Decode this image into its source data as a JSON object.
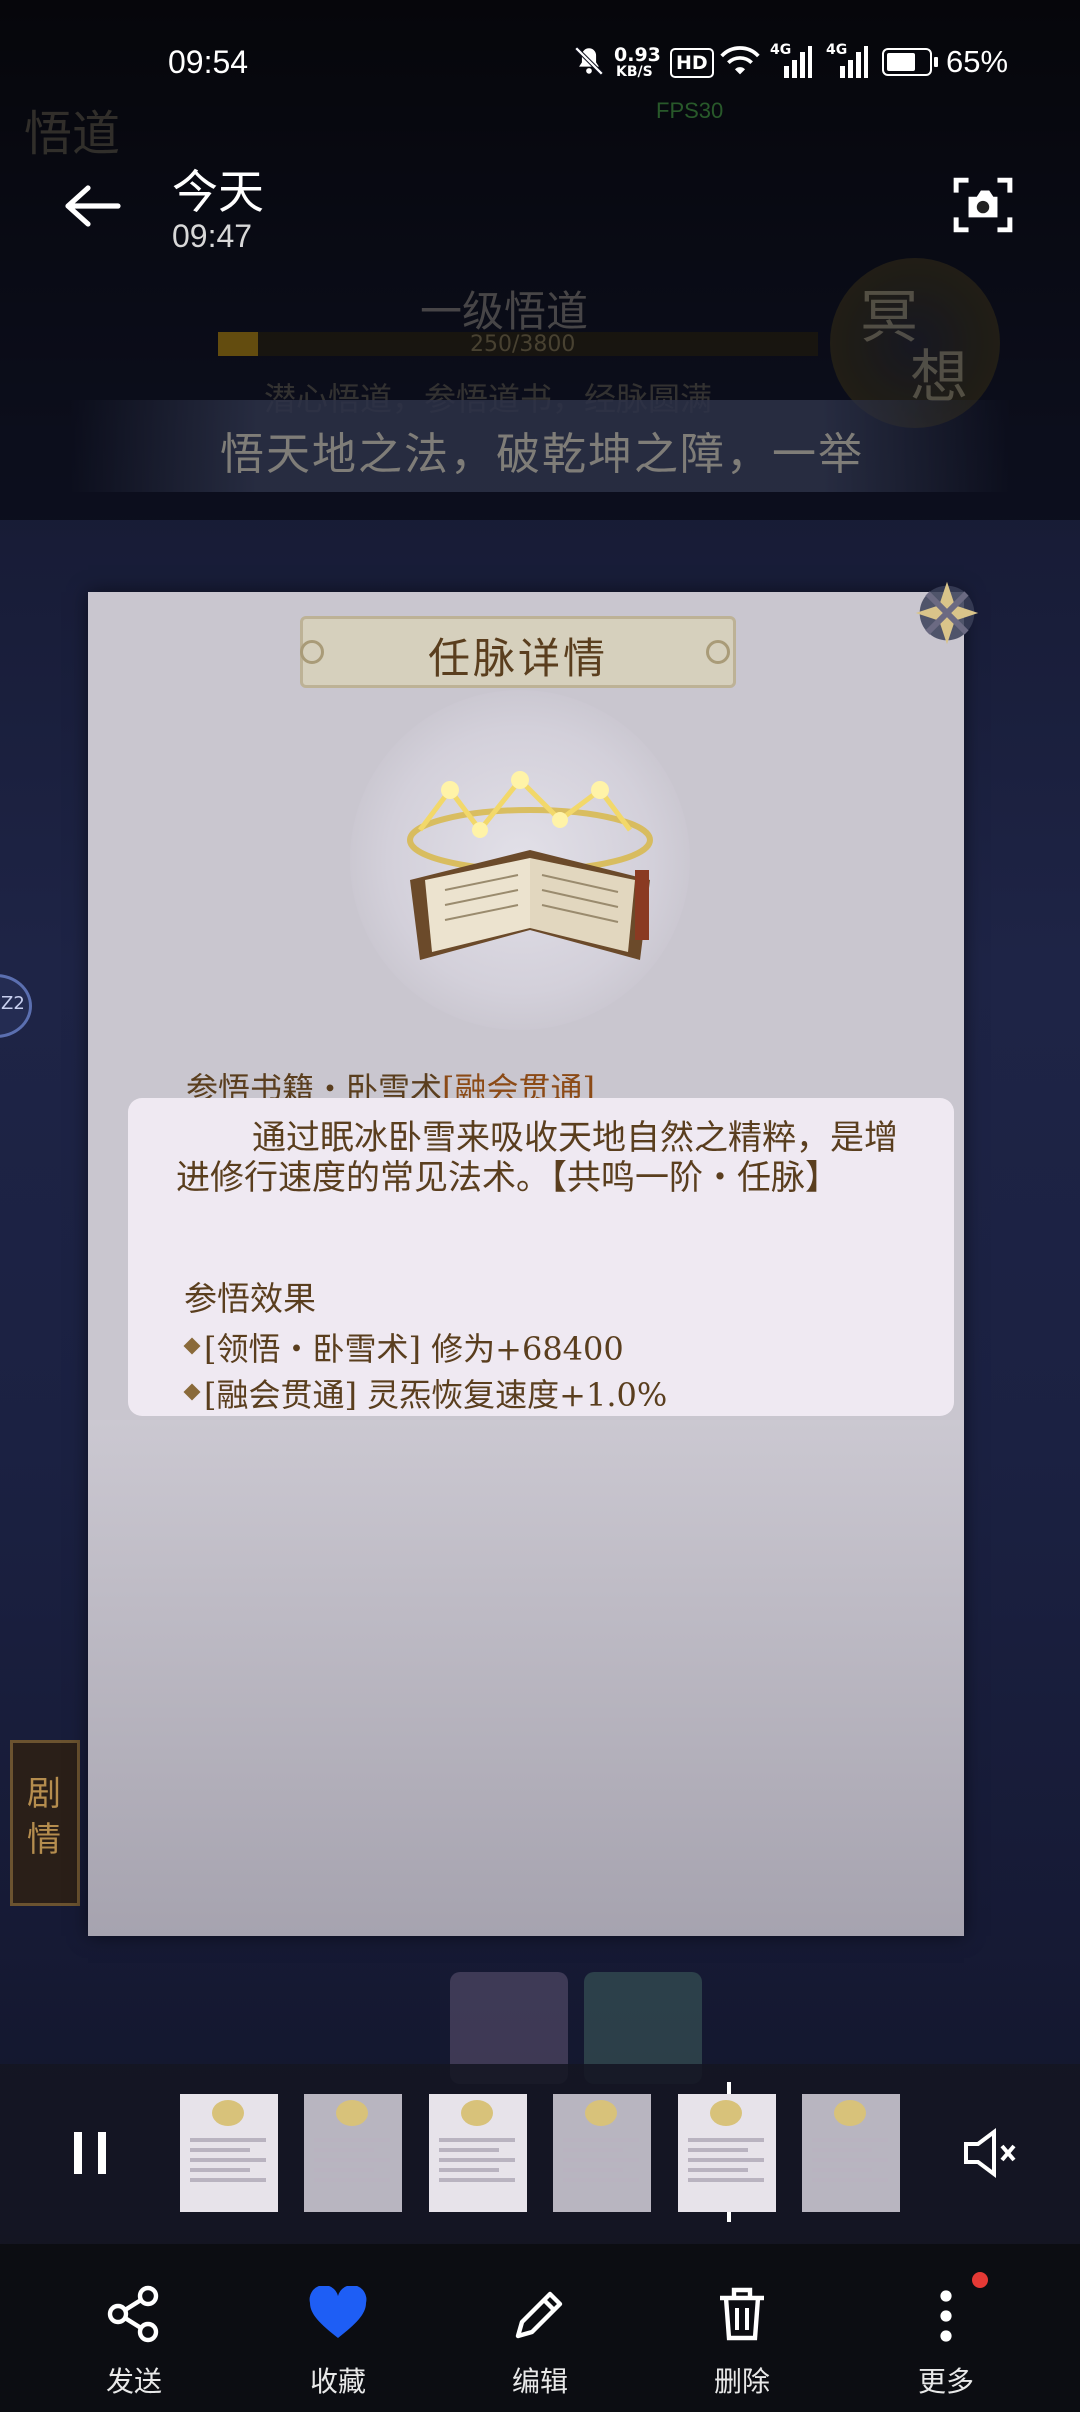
{
  "status_bar": {
    "time": "09:54",
    "net_speed_value": "0.93",
    "net_speed_unit": "KB/S",
    "hd_label": "HD",
    "net_gen_1": "4G",
    "net_gen_2": "4G",
    "battery": "65%"
  },
  "game": {
    "top_left_label": "悟道",
    "fps": "FPS30",
    "level_title": "一级悟道",
    "progress_text": "250/3800",
    "progress_fraction": 0.066,
    "subtitle": "潜心悟道，参悟道书，经脉圆满",
    "banner": "悟天地之法，破乾坤之障，一举",
    "side_badge_1": "冥",
    "side_badge_2": "想",
    "left_bubble": "Z2",
    "side_tab": "剧情"
  },
  "viewer": {
    "date": "今天",
    "time": "09:47"
  },
  "panel": {
    "title": "任脉详情",
    "book_title": "参悟书籍・卧雪术",
    "book_tag": "[融会贯通]",
    "description": "通过眠冰卧雪来吸收天地自然之精粹，是增进修行速度的常见法术。【共鸣一阶・任脉】",
    "effects_header": "参悟效果",
    "effects": [
      "[领悟・卧雪术] 修为+68400",
      "[融会贯通] 灵炁恢复速度+1.0%"
    ]
  },
  "player": {
    "thumbnail_count": 6,
    "playhead_fraction": 0.76
  },
  "toolbar": {
    "share_label": "发送",
    "favorite_label": "收藏",
    "edit_label": "编辑",
    "delete_label": "删除",
    "more_label": "更多"
  },
  "colors": {
    "favorite_accent": "#1e5ef5",
    "notification_dot": "#e53935",
    "panel_text": "#5a3e1e",
    "tag_text": "#8b4a16"
  }
}
